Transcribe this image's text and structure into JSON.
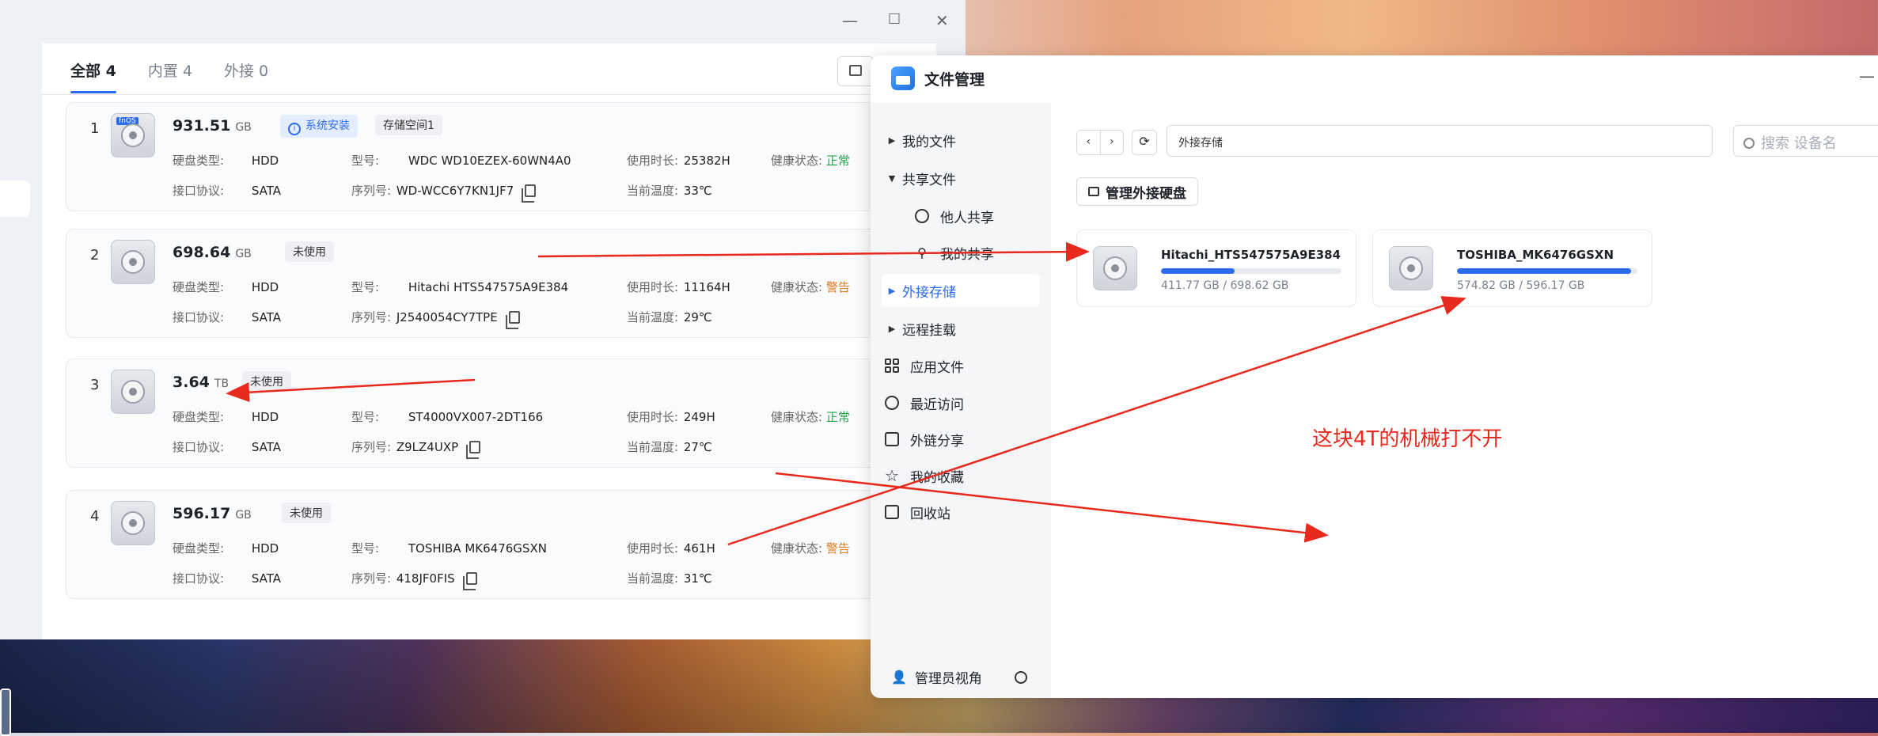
{
  "disk_window": {
    "controls": {
      "minimize": "—",
      "maximize": "☐",
      "close": "✕"
    },
    "tabs": [
      {
        "label": "全部 4",
        "active": true
      },
      {
        "label": "内置 4",
        "active": false
      },
      {
        "label": "外接 0",
        "active": false
      }
    ],
    "labels": {
      "type": "硬盘类型:",
      "protocol": "接口协议:",
      "model": "型号:",
      "serial": "序列号:",
      "hours": "使用时长:",
      "temp": "当前温度:",
      "health": "健康状态:"
    },
    "disks": [
      {
        "index": "1",
        "os_tag": "fnOS",
        "capacity": "931.51",
        "unit": "GB",
        "badges": [
          "系统安装",
          "存储空间1"
        ],
        "type": "HDD",
        "protocol": "SATA",
        "model": "WDC WD10EZEX-60WN4A0",
        "serial": "WD-WCC6Y7KN1JF7",
        "hours": "25382H",
        "temp": "33℃",
        "health": "正常",
        "health_status": "ok"
      },
      {
        "index": "2",
        "capacity": "698.64",
        "unit": "GB",
        "badges": [
          "未使用"
        ],
        "type": "HDD",
        "protocol": "SATA",
        "model": "Hitachi HTS547575A9E384",
        "serial": "J2540054CY7TPE",
        "hours": "11164H",
        "temp": "29℃",
        "health": "警告",
        "health_status": "warn"
      },
      {
        "index": "3",
        "capacity": "3.64",
        "unit": "TB",
        "badges": [
          "未使用"
        ],
        "type": "HDD",
        "protocol": "SATA",
        "model": "ST4000VX007-2DT166",
        "serial": "Z9LZ4UXP",
        "hours": "249H",
        "temp": "27℃",
        "health": "正常",
        "health_status": "ok"
      },
      {
        "index": "4",
        "capacity": "596.17",
        "unit": "GB",
        "badges": [
          "未使用"
        ],
        "type": "HDD",
        "protocol": "SATA",
        "model": "TOSHIBA MK6476GSXN",
        "serial": "418JF0FIS",
        "hours": "461H",
        "temp": "31℃",
        "health": "警告",
        "health_status": "warn"
      }
    ]
  },
  "file_manager": {
    "title": "文件管理",
    "minimize": "—",
    "nav": [
      {
        "label": "我的文件",
        "icon": "caret-right-icon"
      },
      {
        "label": "共享文件",
        "icon": "caret-down-icon"
      },
      {
        "label": "他人共享",
        "icon": "users-icon"
      },
      {
        "label": "我的共享",
        "icon": "share-icon"
      },
      {
        "label": "外接存储",
        "icon": "caret-right-icon",
        "active": true
      },
      {
        "label": "远程挂载",
        "icon": "caret-right-icon"
      },
      {
        "label": "应用文件",
        "icon": "grid-icon"
      },
      {
        "label": "最近访问",
        "icon": "clock-icon"
      },
      {
        "label": "外链分享",
        "icon": "external-link-icon"
      },
      {
        "label": "我的收藏",
        "icon": "star-icon"
      },
      {
        "label": "回收站",
        "icon": "trash-icon"
      }
    ],
    "bottom_label": "管理员视角",
    "path": "外接存储",
    "search_placeholder": "搜索 设备名",
    "manage_button": "管理外接硬盘",
    "external_disks": [
      {
        "name": "Hitachi_HTS547575A9E384",
        "usage": "411.77 GB / 698.62 GB",
        "fill": 0.41
      },
      {
        "name": "TOSHIBA_MK6476GSXN",
        "usage": "574.82 GB / 596.17 GB",
        "fill": 0.964
      }
    ]
  },
  "annotation": "这块4T的机械打不开",
  "colors": {
    "accent": "#2c6cf0",
    "ok": "#22a447",
    "warn": "#e07a1a",
    "annotation": "#e8291d"
  }
}
